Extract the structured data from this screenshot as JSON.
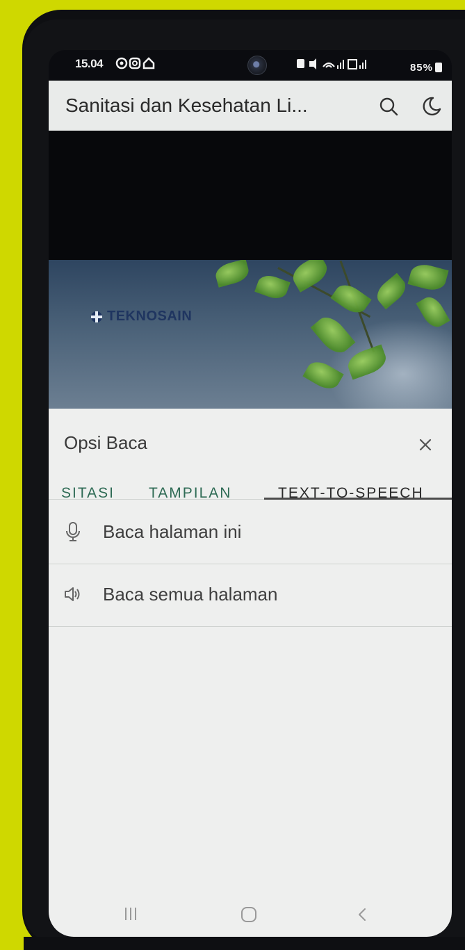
{
  "statusbar": {
    "time": "15.04",
    "left_icons": "●◎⌂",
    "right_text": "■ ✕∷ .∥ ∥ 85%",
    "battery": "85%"
  },
  "appbar": {
    "title": "Sanitasi dan Kesehatan Li...",
    "search_icon": "search-icon",
    "theme_icon": "moon-icon"
  },
  "banner": {
    "brand": "TEKNOSAIN"
  },
  "sheet": {
    "title": "Opsi Baca",
    "close_icon": "close-icon",
    "tabs": [
      {
        "label": "SITASI",
        "active": false
      },
      {
        "label": "TAMPILAN",
        "active": false
      },
      {
        "label": "TEXT-TO-SPEECH",
        "active": true
      }
    ],
    "options": [
      {
        "label": "Baca halaman ini",
        "icon": "microphone-icon"
      },
      {
        "label": "Baca semua halaman",
        "icon": "speaker-icon"
      }
    ]
  },
  "navbar": {
    "recent_icon": "recent-apps-icon",
    "home_icon": "home-icon",
    "back_icon": "back-icon"
  },
  "colors": {
    "background": "#cfd800",
    "appbar": "#e9ebea",
    "sheet": "#eeefee",
    "tab_accent": "#2f6b55"
  }
}
